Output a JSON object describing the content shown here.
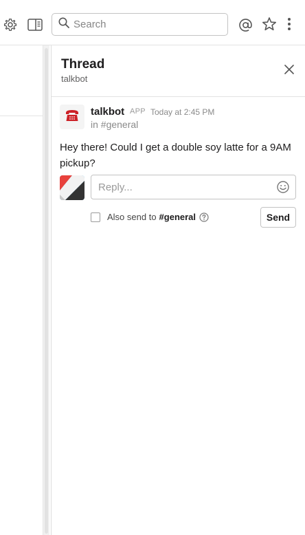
{
  "topbar": {
    "search_placeholder": "Search",
    "icons": [
      "gear-icon",
      "sidebar-toggle-icon",
      "search-icon",
      "at-icon",
      "star-icon",
      "more-vertical-icon"
    ]
  },
  "thread": {
    "title": "Thread",
    "subtitle": "talkbot",
    "message": {
      "author": "talkbot",
      "badge": "APP",
      "time": "Today at 2:45 PM",
      "channel": "in #general",
      "text": "Hey there! Could I get a double soy latte for a 9AM pickup?",
      "avatar_icon": "telephone-icon"
    },
    "reply": {
      "placeholder": "Reply...",
      "also_send_label": "Also send to",
      "also_send_channel": "#general",
      "also_send_checked": false,
      "send_label": "Send"
    }
  },
  "colors": {
    "accent_red": "#cc2127",
    "avatar_teal": "#3aa3e3"
  }
}
